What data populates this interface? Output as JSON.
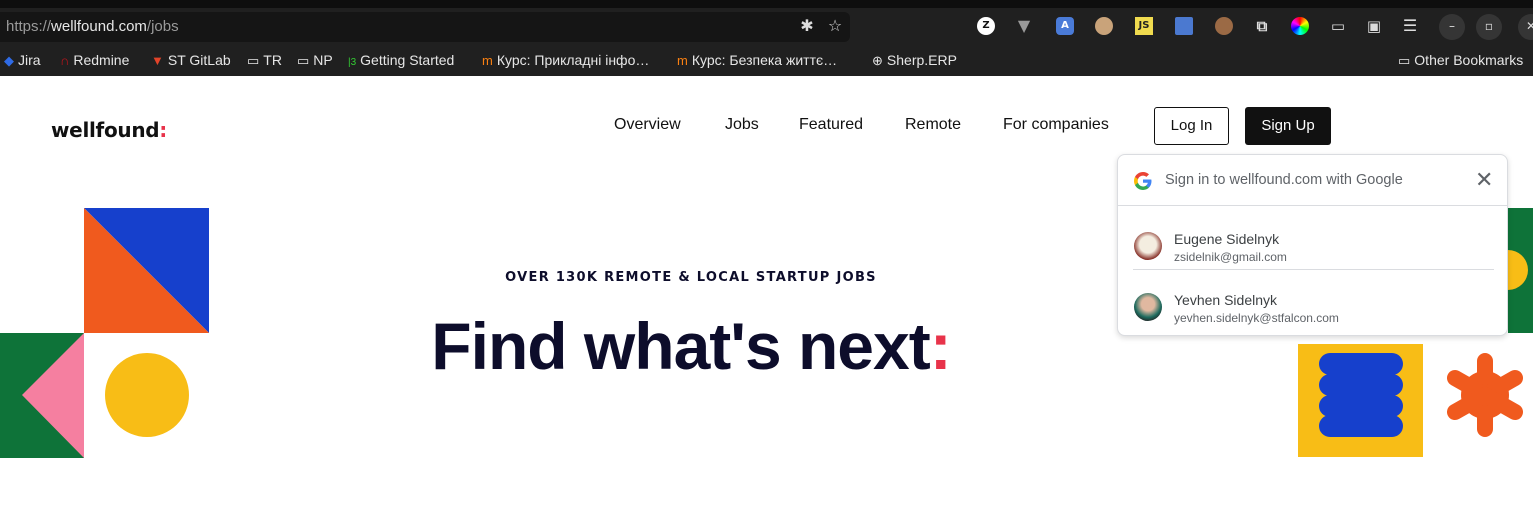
{
  "browser": {
    "url_scheme": "https://",
    "url_host": "wellfound.com",
    "url_path": "/jobs",
    "url_icons": [
      "bug-icon",
      "star-icon"
    ],
    "extensions": [
      "z-extension",
      "vue-devtools",
      "translate",
      "owl-extension",
      "js-extension",
      "save-extension",
      "cookie-extension",
      "puzzle-extensions",
      "color-picker"
    ],
    "bookmarks": [
      {
        "label": "Jira",
        "icon": "jira-icon"
      },
      {
        "label": "Redmine",
        "icon": "redmine-icon"
      },
      {
        "label": "ST GitLab",
        "icon": "gitlab-icon"
      },
      {
        "label": "TR",
        "icon": "folder-icon"
      },
      {
        "label": "NP",
        "icon": "folder-icon"
      },
      {
        "label": "Getting Started",
        "icon": "terminal-icon"
      },
      {
        "label": "Курс: Прикладні інфо…",
        "icon": "moodle-icon"
      },
      {
        "label": "Курс: Безпека життє…",
        "icon": "moodle-icon"
      },
      {
        "label": "Sherp.ERP",
        "icon": "globe-icon"
      }
    ],
    "other_bookmarks": "Other Bookmarks"
  },
  "site": {
    "logo": "wellfound",
    "logo_colon": ":",
    "nav": [
      "Overview",
      "Jobs",
      "Featured",
      "Remote",
      "For companies"
    ],
    "login": "Log In",
    "signup": "Sign Up",
    "eyebrow": "OVER 130K REMOTE & LOCAL STARTUP JOBS",
    "hero": "Find what's next",
    "hero_colon": ":",
    "colors": {
      "accent": "#e8334a",
      "blue": "#1640cc",
      "orange": "#f05a1e",
      "green": "#0e7339",
      "yellow": "#f8bd16",
      "pink": "#f57fa0"
    }
  },
  "google_popup": {
    "title": "Sign in to wellfound.com with Google",
    "accounts": [
      {
        "name": "Eugene Sidelnyk",
        "email": "zsidelnik@gmail.com"
      },
      {
        "name": "Yevhen Sidelnyk",
        "email": "yevhen.sidelnyk@stfalcon.com"
      }
    ]
  }
}
